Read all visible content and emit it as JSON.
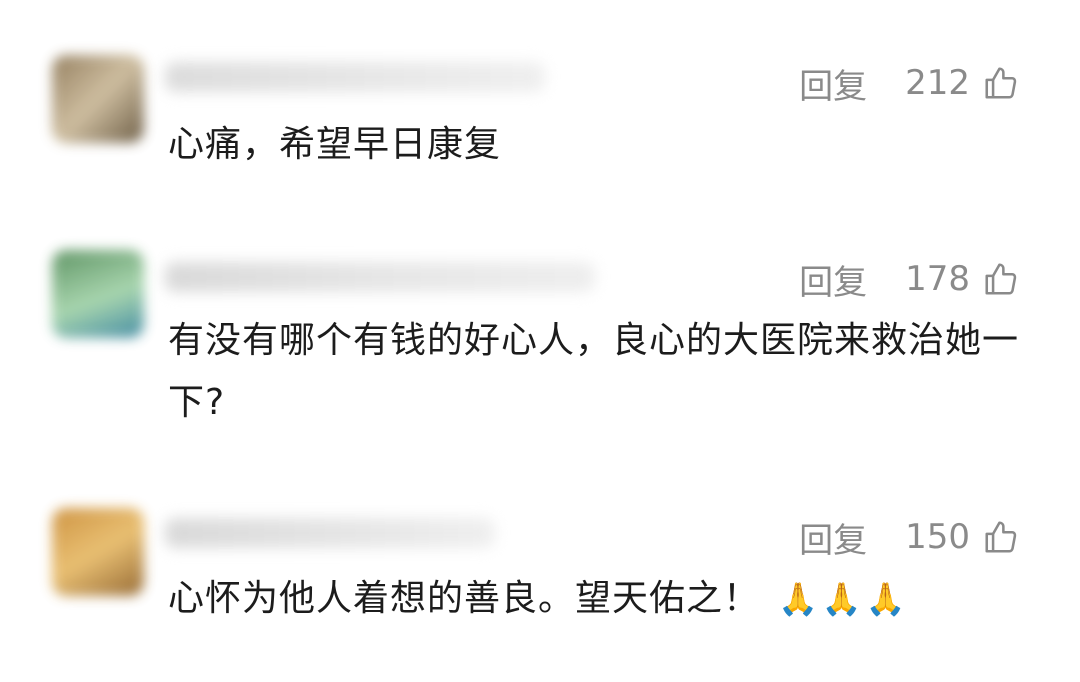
{
  "comments": [
    {
      "reply_label": "回复",
      "like_count": "212",
      "text": "心痛，希望早日康复",
      "emoji": "",
      "avatar_colors": [
        "#8a7350",
        "#c9b796",
        "#5e4d33"
      ]
    },
    {
      "reply_label": "回复",
      "like_count": "178",
      "text": "有没有哪个有钱的好心人，良心的大医院来救治她一下?",
      "emoji": "",
      "avatar_colors": [
        "#4f8a55",
        "#9fd1a6",
        "#2f7f9a"
      ]
    },
    {
      "reply_label": "回复",
      "like_count": "150",
      "text": "心怀为他人着想的善良。望天佑之！",
      "emoji": "🙏🙏🙏",
      "avatar_colors": [
        "#c9892f",
        "#e7b964",
        "#8a5a1f"
      ]
    }
  ]
}
